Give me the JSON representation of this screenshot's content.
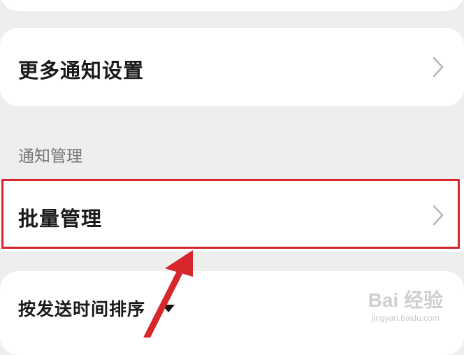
{
  "settings": {
    "more_notification_settings": "更多通知设置",
    "section_title": "通知管理",
    "batch_management": "批量管理",
    "sort_by_send_time": "按发送时间排序"
  },
  "annotation": {
    "highlight_color": "#d7262c",
    "arrow_color": "#d7262c"
  },
  "watermark": {
    "main": "Bai 经验",
    "sub": "jingyan.baidu.com"
  }
}
